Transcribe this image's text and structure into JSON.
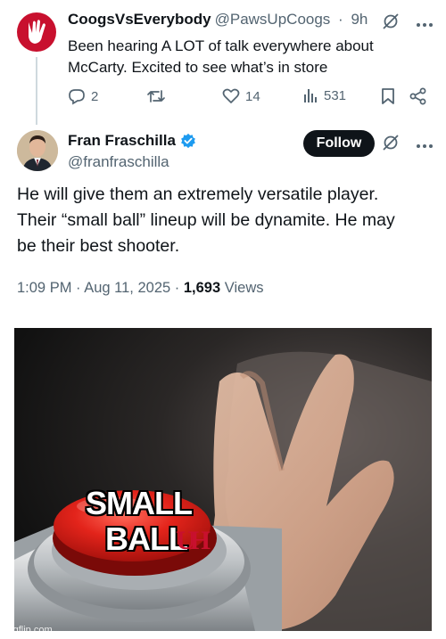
{
  "reply_tweet": {
    "display_name": "CoogsVsEverybody",
    "handle": "@PawsUpCoogs",
    "separator": "·",
    "time": "9h",
    "text_line1": "Been hearing A LOT of talk everywhere about",
    "text_line2": "McCarty. Excited to see what’s in store",
    "actions": {
      "replies": "2",
      "retweets": "",
      "likes": "14",
      "views": "531"
    }
  },
  "main_tweet": {
    "display_name": "Fran Fraschilla",
    "handle": "@franfraschilla",
    "follow_label": "Follow",
    "text_line1": "He will give them an extremely versatile player.",
    "text_line2": "Their “small ball” lineup will be dynamite. He may",
    "text_line3": "be their best shooter.",
    "time": "1:09 PM",
    "dot": "·",
    "date": "Aug 11, 2025",
    "dot2": "·",
    "views_count": "1,693",
    "views_label": "Views"
  },
  "meme": {
    "button_label_line1": "SMALL",
    "button_label_line2": "BALL",
    "logo_text": "UH",
    "watermark": "imgflip.com"
  },
  "colors": {
    "text": "#0f1419",
    "secondary": "#536471",
    "verified": "#1d9bf0",
    "brand_red": "#c8102e",
    "follow_bg": "#0f1419"
  }
}
